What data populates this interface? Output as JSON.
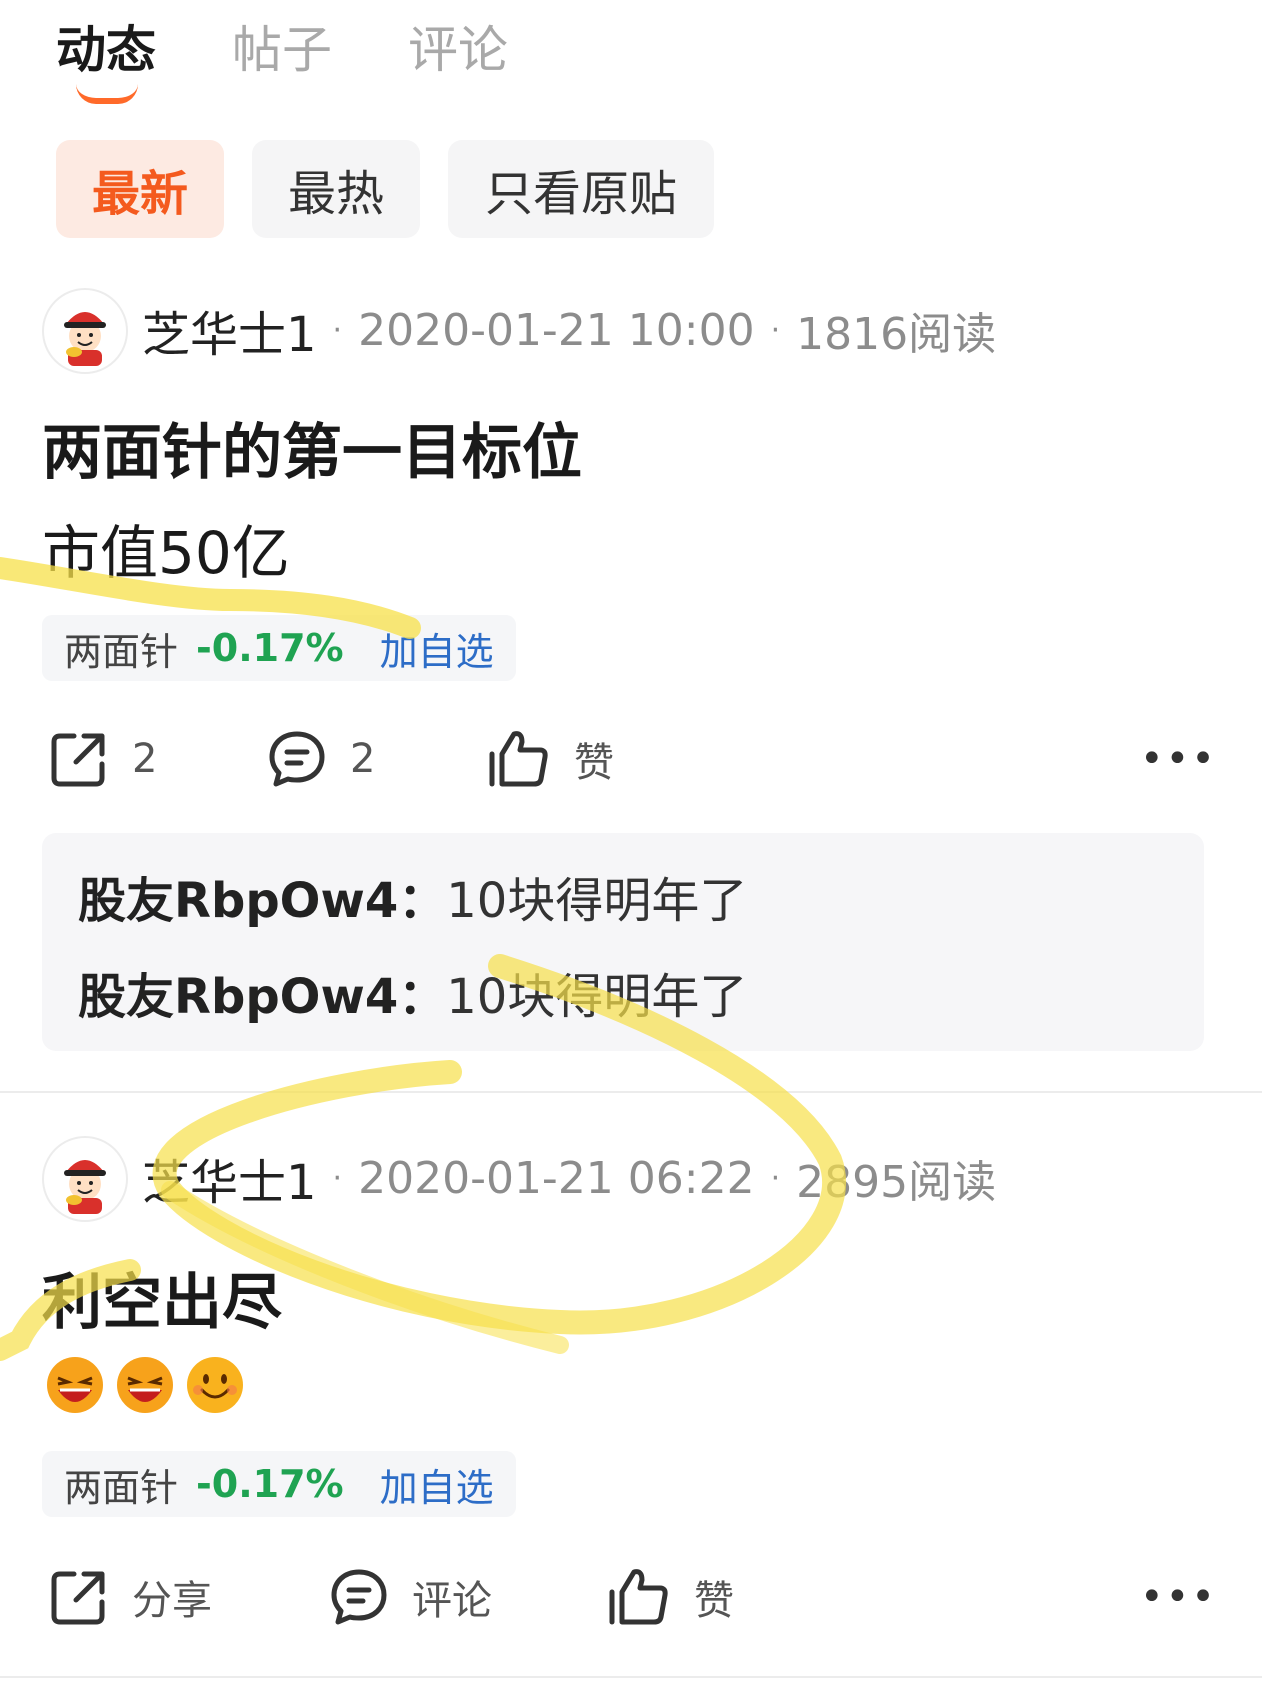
{
  "tabs": [
    {
      "label": "动态",
      "active": true
    },
    {
      "label": "帖子",
      "active": false
    },
    {
      "label": "评论",
      "active": false
    }
  ],
  "filters": [
    {
      "label": "最新",
      "active": true
    },
    {
      "label": "最热",
      "active": false
    },
    {
      "label": "只看原贴",
      "active": false
    }
  ],
  "posts": [
    {
      "author": "芝华士1",
      "time": "2020-01-21 10:00",
      "reads": "1816阅读",
      "title": "两面针的第一目标位",
      "body": "市值50亿",
      "stock": {
        "name": "两面针",
        "change": "-0.17%",
        "add_label": "加自选"
      },
      "actions": {
        "share": "2",
        "comment": "2",
        "like": "赞"
      },
      "more": "•••",
      "comments": [
        {
          "user": "股友RbpOw4：",
          "text": "10块得明年了"
        },
        {
          "user": "股友RbpOw4：",
          "text": "10块得明年了"
        }
      ]
    },
    {
      "author": "芝华士1",
      "time": "2020-01-21 06:22",
      "reads": "2895阅读",
      "title": "利空出尽",
      "emojis": [
        "laughing-emoji",
        "laughing-emoji",
        "smile-emoji"
      ],
      "stock": {
        "name": "两面针",
        "change": "-0.17%",
        "add_label": "加自选"
      },
      "actions": {
        "share": "分享",
        "comment": "评论",
        "like": "赞"
      },
      "more": "•••"
    }
  ],
  "colors": {
    "accent": "#ff6a2a",
    "active_filter_text": "#f45a1e",
    "stock_change": "#1fa352",
    "add_watchlist": "#2d6dc7",
    "highlight_mark": "#f7e04a"
  }
}
